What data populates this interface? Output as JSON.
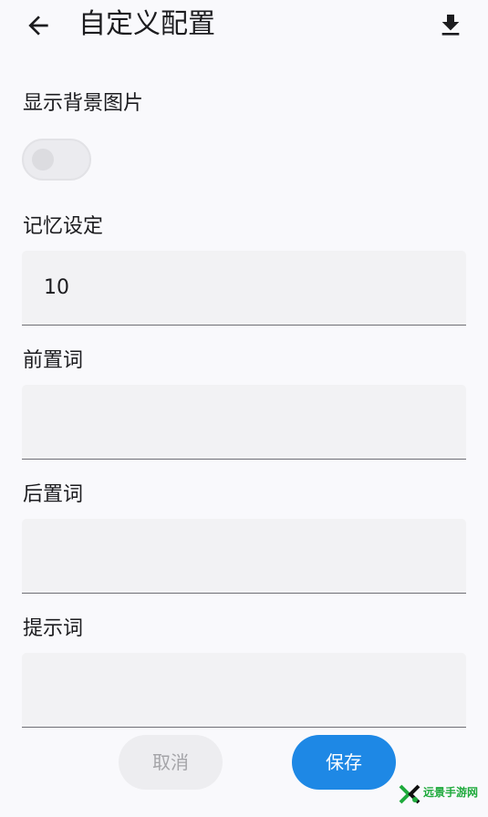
{
  "header": {
    "title": "自定义配置",
    "back_icon": "arrow-left-icon",
    "download_icon": "download-icon"
  },
  "settings": {
    "background_image_label": "显示背景图片",
    "background_image_enabled": false,
    "memory_label": "记忆设定",
    "memory_value": "10",
    "prefix_label": "前置词",
    "prefix_value": "",
    "suffix_label": "后置词",
    "suffix_value": "",
    "prompt_label": "提示词",
    "prompt_value": ""
  },
  "actions": {
    "cancel_label": "取消",
    "save_label": "保存"
  },
  "watermark": {
    "text": "远景手游网"
  },
  "colors": {
    "accent": "#1e88e5",
    "background": "#f9f9fc",
    "field_background": "#f2f2f4"
  }
}
